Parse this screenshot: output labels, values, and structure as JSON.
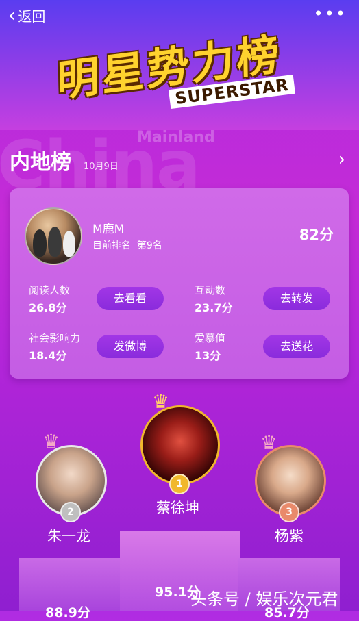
{
  "nav": {
    "back_label": "返回",
    "more_label": "•••"
  },
  "banner": {
    "title_cn": "明星势力榜",
    "title_en": "SUPERSTAR"
  },
  "section": {
    "bg_word": "China",
    "bg_sub": "Mainland",
    "title": "内地榜",
    "date": "10月9日"
  },
  "card": {
    "name": "M鹿M",
    "rank_label": "目前排名",
    "rank_value": "第9名",
    "score": "82分",
    "metrics": [
      {
        "label": "阅读人数",
        "value": "26.8分",
        "button": "去看看"
      },
      {
        "label": "互动数",
        "value": "23.7分",
        "button": "去转发"
      },
      {
        "label": "社会影响力",
        "value": "18.4分",
        "button": "发微博"
      },
      {
        "label": "爱慕值",
        "value": "13分",
        "button": "去送花"
      }
    ]
  },
  "podium": [
    {
      "rank": "2",
      "name": "朱一龙",
      "score": "88.9分"
    },
    {
      "rank": "1",
      "name": "蔡徐坤",
      "score": "95.1分"
    },
    {
      "rank": "3",
      "name": "杨紫",
      "score": "85.7分"
    }
  ],
  "watermark": "头条号 / 娱乐次元君",
  "colors": {
    "gold": "#f1b82c",
    "silver": "#bfbfbf",
    "bronze": "#e98a6b"
  }
}
